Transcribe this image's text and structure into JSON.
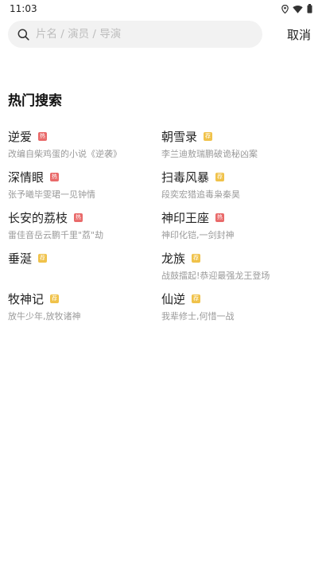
{
  "status_bar": {
    "time": "11:03",
    "icons": [
      "location-icon",
      "wifi-icon",
      "battery-icon"
    ]
  },
  "search": {
    "placeholder": "片名 / 演员 / 导演",
    "value": "",
    "cancel_label": "取消"
  },
  "hot_section": {
    "title": "热门搜索",
    "items": [
      {
        "title": "逆爱",
        "tag": "热",
        "tag_type": "hot",
        "desc": "改编自柴鸡蛋的小说《逆袭》"
      },
      {
        "title": "朝雪录",
        "tag": "荐",
        "tag_type": "rec",
        "desc": "李兰迪敖瑞鹏破诡秘凶案"
      },
      {
        "title": "深情眼",
        "tag": "热",
        "tag_type": "hot",
        "desc": "张予曦毕雯珺一见钟情"
      },
      {
        "title": "扫毒风暴",
        "tag": "荐",
        "tag_type": "rec",
        "desc": "段奕宏猎追毒枭秦昊"
      },
      {
        "title": "长安的荔枝",
        "tag": "热",
        "tag_type": "hot",
        "desc": "雷佳音岳云鹏千里\"荔\"劫"
      },
      {
        "title": "神印王座",
        "tag": "热",
        "tag_type": "hot",
        "desc": "神印化铠,一剑封神"
      },
      {
        "title": "垂涎",
        "tag": "荐",
        "tag_type": "rec",
        "desc": ""
      },
      {
        "title": "龙族",
        "tag": "荐",
        "tag_type": "rec",
        "desc": "战鼓擂起!恭迎最强龙王登场"
      },
      {
        "title": "牧神记",
        "tag": "荐",
        "tag_type": "rec",
        "desc": "放牛少年,放牧诸神"
      },
      {
        "title": "仙逆",
        "tag": "荐",
        "tag_type": "rec",
        "desc": "我辈修士,何惜一战"
      }
    ]
  },
  "colors": {
    "hot_tag": "#e96a6a",
    "rec_tag": "#f0c24a",
    "search_bg": "#f2f2f2"
  }
}
